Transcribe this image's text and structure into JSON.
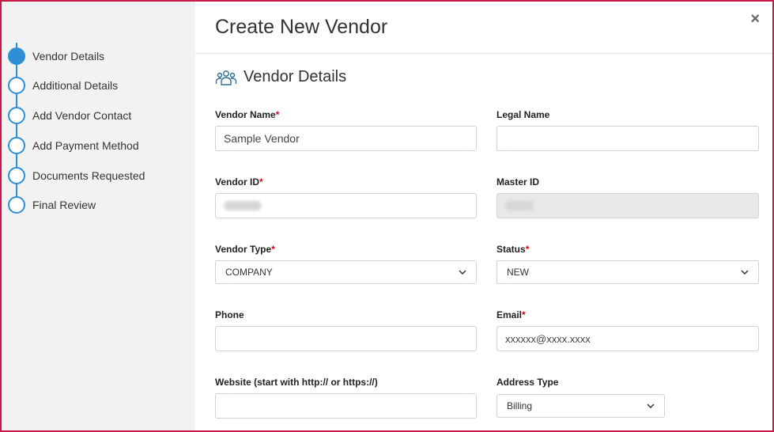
{
  "steps": [
    {
      "label": "Vendor Details",
      "active": true
    },
    {
      "label": "Additional Details",
      "active": false
    },
    {
      "label": "Add Vendor Contact",
      "active": false
    },
    {
      "label": "Add Payment Method",
      "active": false
    },
    {
      "label": "Documents Requested",
      "active": false
    },
    {
      "label": "Final Review",
      "active": false
    }
  ],
  "modal": {
    "title": "Create New Vendor",
    "close_symbol": "×",
    "section_title": "Vendor Details",
    "section_icon": "users-icon"
  },
  "form": {
    "vendor_name": {
      "label": "Vendor Name",
      "required_mark": "*",
      "value": "Sample Vendor"
    },
    "legal_name": {
      "label": "Legal Name",
      "value": ""
    },
    "vendor_id": {
      "label": "Vendor ID",
      "required_mark": "*",
      "value": "(redacted)"
    },
    "master_id": {
      "label": "Master ID",
      "value": "(redacted)"
    },
    "vendor_type": {
      "label": "Vendor Type",
      "required_mark": "*",
      "value": "COMPANY"
    },
    "status": {
      "label": "Status",
      "required_mark": "*",
      "value": "NEW"
    },
    "phone": {
      "label": "Phone",
      "value": ""
    },
    "email": {
      "label": "Email",
      "required_mark": "*",
      "value": "xxxxxx@xxxx.xxxx"
    },
    "website": {
      "label": "Website (start with http:// or https://)",
      "value": ""
    },
    "address_type": {
      "label": "Address Type",
      "value": "Billing"
    }
  },
  "colors": {
    "accent": "#2d8fd5",
    "frame": "#c8194a",
    "required": "#d0021b"
  }
}
